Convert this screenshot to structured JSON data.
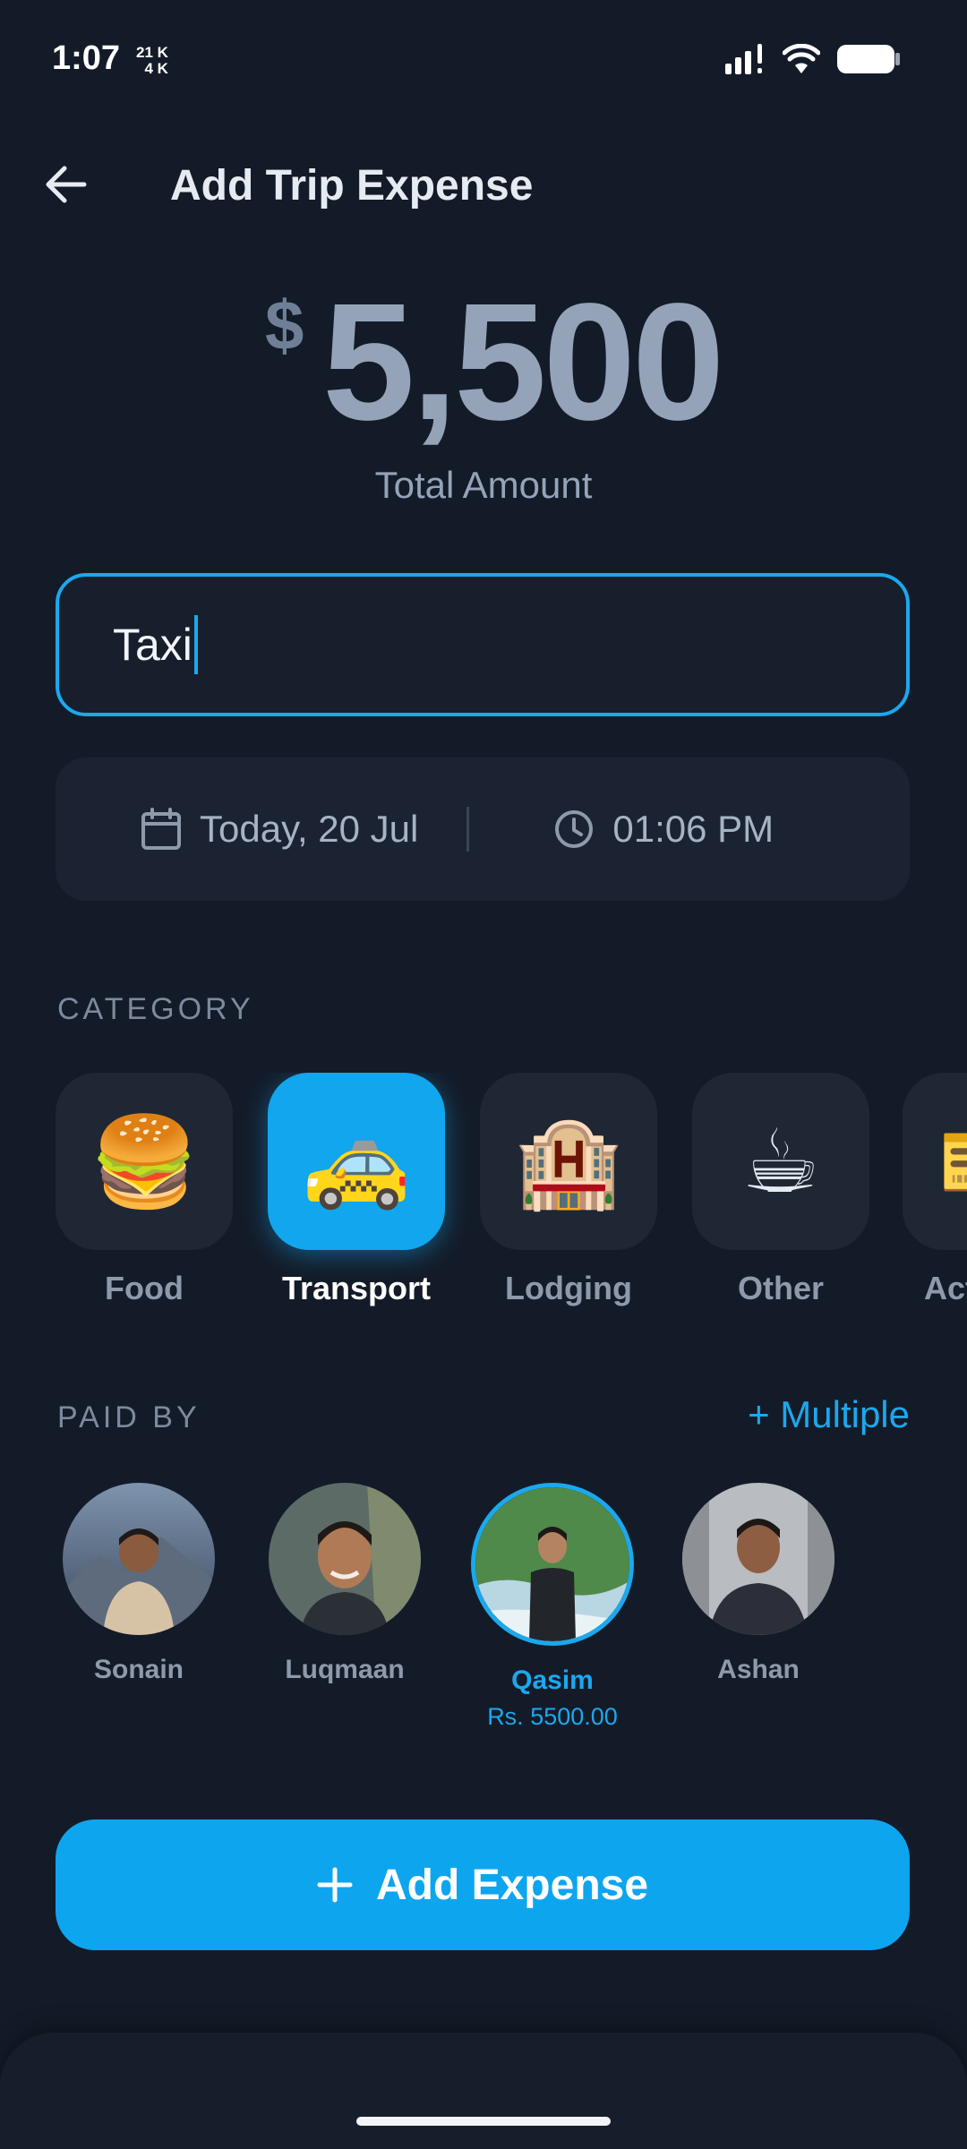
{
  "status_bar": {
    "time": "1:07",
    "network_up": "21 K",
    "network_down": "4 K"
  },
  "header": {
    "title": "Add Trip Expense"
  },
  "amount": {
    "currency": "$",
    "value": "5,500",
    "label": "Total Amount"
  },
  "description_input": {
    "value": "Taxi"
  },
  "datetime": {
    "date": "Today, 20 Jul",
    "time": "01:06 PM"
  },
  "category": {
    "label": "CATEGORY",
    "items": [
      {
        "label": "Food",
        "emoji": "🍔",
        "selected": false
      },
      {
        "label": "Transport",
        "emoji": "🚕",
        "selected": true
      },
      {
        "label": "Lodging",
        "emoji": "🏨",
        "selected": false
      },
      {
        "label": "Other",
        "emoji": "☕",
        "selected": false
      },
      {
        "label": "Act",
        "emoji": "🎫",
        "selected": false
      }
    ]
  },
  "paid_by": {
    "label": "PAID BY",
    "multiple_label": "+ Multiple",
    "payers": [
      {
        "name": "Sonain",
        "selected": false
      },
      {
        "name": "Luqmaan",
        "selected": false
      },
      {
        "name": "Qasim",
        "selected": true,
        "share": "Rs. 5500.00"
      },
      {
        "name": "Ashan",
        "selected": false
      }
    ]
  },
  "add_button": {
    "label": "Add Expense"
  },
  "colors": {
    "background": "#141b28",
    "accent": "#0ea5ef",
    "muted_text": "#94a3b8"
  }
}
